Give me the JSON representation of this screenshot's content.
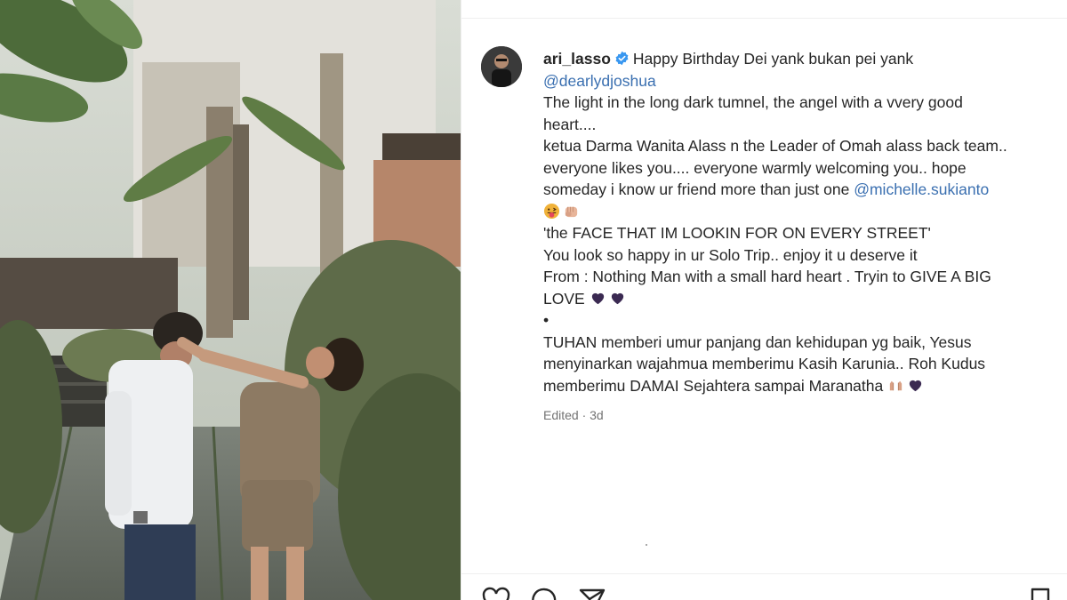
{
  "post": {
    "username": "ari_lasso",
    "verified_icon": "verified-badge-icon",
    "caption_lines": {
      "l1_text": "Happy Birthday Dei yank bukan pei yank",
      "l2_mention": "@dearlydjoshua",
      "l3": "The light in the long dark tumnel, the angel with a vvery good",
      "l4": "heart....",
      "l5": "ketua Darma Wanita Alass n the Leader of Omah alass back team..",
      "l6": "everyone likes you.... everyone warmly welcoming you.. hope",
      "l7_text": "someday i know ur friend more than just one ",
      "l7_mention": "@michelle.sukianto",
      "l9": "'the FACE THAT IM LOOKIN FOR ON EVERY STREET'",
      "l10": "You look so happy in ur Solo Trip.. enjoy it u deserve it",
      "l11": "From : Nothing Man with a small hard heart . Tryin to GIVE A BIG",
      "l12": "LOVE",
      "l13": "•",
      "l14": "TUHAN memberi umur panjang dan kehidupan yg baik, Yesus",
      "l15": "menyinarkan wajahmua memberimu Kasih Karunia.. Roh Kudus",
      "l16": "memberimu DAMAI Sejahtera sampai Maranatha"
    },
    "emojis": [
      "tongue-out-face-emoji",
      "fist-emoji",
      "purple-heart-emoji",
      "purple-heart-emoji",
      "raised-hands-emoji",
      "purple-heart-emoji"
    ],
    "meta": "Edited · 3d"
  },
  "actions": [
    "like-icon",
    "comment-icon",
    "share-icon",
    "save-icon"
  ],
  "colors": {
    "mention": "#3a6fb0",
    "verified": "#3897f0",
    "muted_text": "#737373",
    "purple_heart": "#3b2a52"
  }
}
